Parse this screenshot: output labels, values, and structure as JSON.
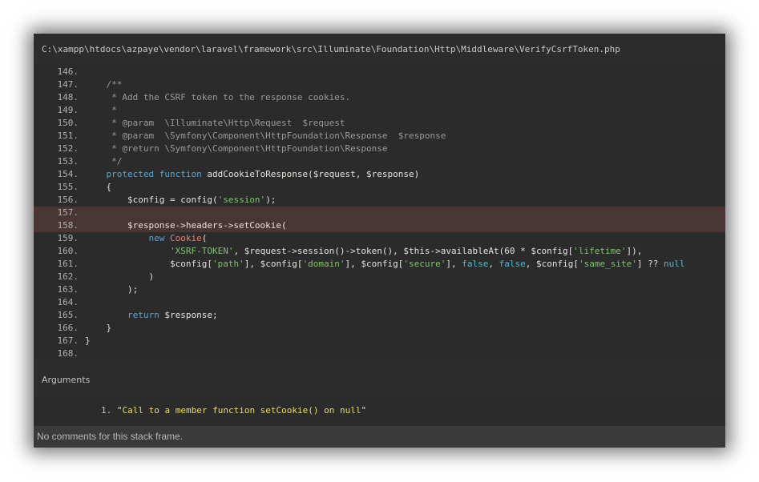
{
  "file_path": "C:\\xampp\\htdocs\\azpaye\\vendor\\laravel\\framework\\src\\Illuminate\\Foundation\\Http\\Middleware\\VerifyCsrfToken.php",
  "code_lines": [
    {
      "num": "146.",
      "segments": []
    },
    {
      "num": "147.",
      "segments": [
        {
          "t": "    /**",
          "c": "c-comment"
        }
      ]
    },
    {
      "num": "148.",
      "segments": [
        {
          "t": "     * Add the CSRF token to the response cookies.",
          "c": "c-comment"
        }
      ]
    },
    {
      "num": "149.",
      "segments": [
        {
          "t": "     *",
          "c": "c-comment"
        }
      ]
    },
    {
      "num": "150.",
      "segments": [
        {
          "t": "     * @param  \\Illuminate\\Http\\Request  $request",
          "c": "c-comment"
        }
      ]
    },
    {
      "num": "151.",
      "segments": [
        {
          "t": "     * @param  \\Symfony\\Component\\HttpFoundation\\Response  $response",
          "c": "c-comment"
        }
      ]
    },
    {
      "num": "152.",
      "segments": [
        {
          "t": "     * @return \\Symfony\\Component\\HttpFoundation\\Response",
          "c": "c-comment"
        }
      ]
    },
    {
      "num": "153.",
      "segments": [
        {
          "t": "     */",
          "c": "c-comment"
        }
      ]
    },
    {
      "num": "154.",
      "segments": [
        {
          "t": "    ",
          "c": "c-plain"
        },
        {
          "t": "protected",
          "c": "c-kw"
        },
        {
          "t": " ",
          "c": "c-plain"
        },
        {
          "t": "function",
          "c": "c-kw"
        },
        {
          "t": " addCookieToResponse($request, $response)",
          "c": "c-plain"
        }
      ]
    },
    {
      "num": "155.",
      "segments": [
        {
          "t": "    {",
          "c": "c-plain"
        }
      ]
    },
    {
      "num": "156.",
      "segments": [
        {
          "t": "        $config = config(",
          "c": "c-plain"
        },
        {
          "t": "'session'",
          "c": "c-str"
        },
        {
          "t": ");",
          "c": "c-plain"
        }
      ]
    },
    {
      "num": "157.",
      "segments": [],
      "highlight": true
    },
    {
      "num": "158.",
      "segments": [
        {
          "t": "        $response->headers->setCookie(",
          "c": "c-plain"
        }
      ],
      "highlight": true
    },
    {
      "num": "159.",
      "segments": [
        {
          "t": "            ",
          "c": "c-plain"
        },
        {
          "t": "new",
          "c": "c-kw"
        },
        {
          "t": " ",
          "c": "c-plain"
        },
        {
          "t": "Cookie",
          "c": "c-class"
        },
        {
          "t": "(",
          "c": "c-plain"
        }
      ]
    },
    {
      "num": "160.",
      "segments": [
        {
          "t": "                ",
          "c": "c-plain"
        },
        {
          "t": "'XSRF-TOKEN'",
          "c": "c-str"
        },
        {
          "t": ", $request->session()->token(), $this->availableAt(60 * $config[",
          "c": "c-plain"
        },
        {
          "t": "'lifetime'",
          "c": "c-str"
        },
        {
          "t": "]),",
          "c": "c-plain"
        }
      ]
    },
    {
      "num": "161.",
      "segments": [
        {
          "t": "                $config[",
          "c": "c-plain"
        },
        {
          "t": "'path'",
          "c": "c-str"
        },
        {
          "t": "], $config[",
          "c": "c-plain"
        },
        {
          "t": "'domain'",
          "c": "c-str"
        },
        {
          "t": "], $config[",
          "c": "c-plain"
        },
        {
          "t": "'secure'",
          "c": "c-str"
        },
        {
          "t": "], ",
          "c": "c-plain"
        },
        {
          "t": "false",
          "c": "c-bool"
        },
        {
          "t": ", ",
          "c": "c-plain"
        },
        {
          "t": "false",
          "c": "c-bool"
        },
        {
          "t": ", $config[",
          "c": "c-plain"
        },
        {
          "t": "'same_site'",
          "c": "c-str"
        },
        {
          "t": "] ?? ",
          "c": "c-plain"
        },
        {
          "t": "null",
          "c": "c-bool"
        }
      ]
    },
    {
      "num": "162.",
      "segments": [
        {
          "t": "            )",
          "c": "c-plain"
        }
      ]
    },
    {
      "num": "163.",
      "segments": [
        {
          "t": "        );",
          "c": "c-plain"
        }
      ]
    },
    {
      "num": "164.",
      "segments": []
    },
    {
      "num": "165.",
      "segments": [
        {
          "t": "        ",
          "c": "c-plain"
        },
        {
          "t": "return",
          "c": "c-kw"
        },
        {
          "t": " $response;",
          "c": "c-plain"
        }
      ]
    },
    {
      "num": "166.",
      "segments": [
        {
          "t": "    }",
          "c": "c-plain"
        }
      ]
    },
    {
      "num": "167.",
      "segments": [
        {
          "t": "}",
          "c": "c-plain"
        }
      ]
    },
    {
      "num": "168.",
      "segments": []
    }
  ],
  "arguments": {
    "title": "Arguments",
    "items": [
      {
        "index": "1.",
        "open_quote": "\"",
        "value": "Call to a member function setCookie() on null",
        "close_quote": "\""
      }
    ]
  },
  "comments_text": "No comments for this stack frame.",
  "colors": {
    "highlight_row": "#4a3535",
    "keyword": "#5aa6d6",
    "string": "#7fc36a",
    "comment": "#9a9a9a",
    "class_name": "#e0806c",
    "boolean": "#4fb8c9"
  }
}
